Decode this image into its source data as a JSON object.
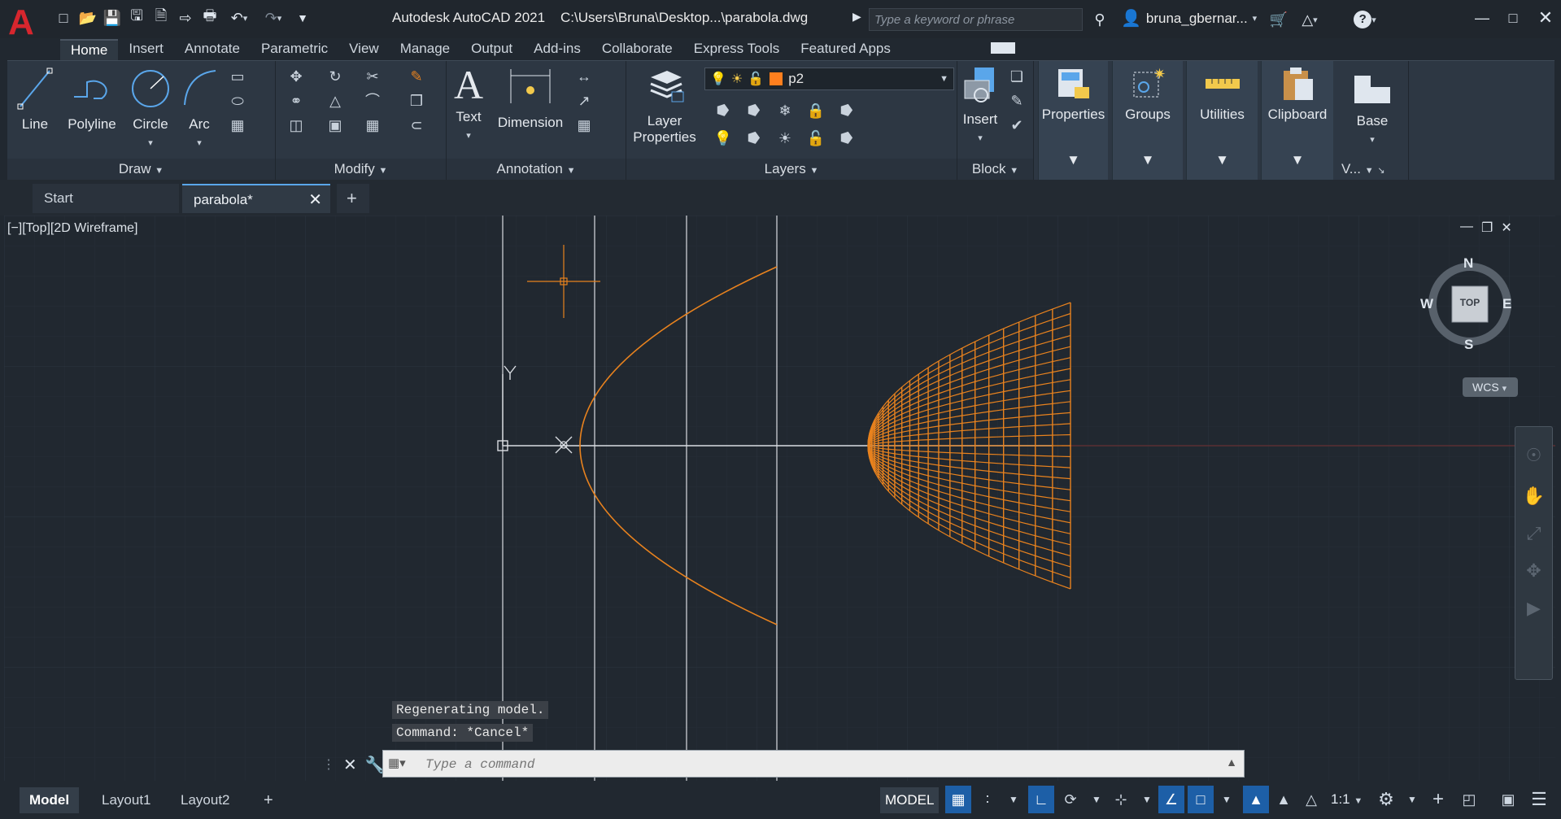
{
  "app": {
    "logo_letter": "A",
    "title": "Autodesk AutoCAD 2021",
    "filepath": "C:\\Users\\Bruna\\Desktop...\\parabola.dwg",
    "search_placeholder": "Type a keyword or phrase",
    "user": "bruna_gbernar...",
    "window_controls": [
      "minimize-icon",
      "maximize-icon",
      "close-icon"
    ]
  },
  "quick_access": [
    "new-icon",
    "open-icon",
    "save-icon",
    "save-as-icon",
    "publish-icon",
    "share-icon",
    "plot-icon",
    "undo-icon",
    "redo-icon",
    "customize-icon"
  ],
  "menu_tabs": [
    "Home",
    "Insert",
    "Annotate",
    "Parametric",
    "View",
    "Manage",
    "Output",
    "Add-ins",
    "Collaborate",
    "Express Tools",
    "Featured Apps"
  ],
  "active_tab": "Home",
  "ribbon": {
    "draw": {
      "title": "Draw",
      "tools": [
        "Line",
        "Polyline",
        "Circle",
        "Arc"
      ]
    },
    "modify": {
      "title": "Modify"
    },
    "annotation": {
      "title": "Annotation",
      "tools": [
        "Text",
        "Dimension"
      ]
    },
    "layers": {
      "title": "Layers",
      "layer_properties_line1": "Layer",
      "layer_properties_line2": "Properties",
      "current_layer": "p2",
      "layer_color": "#ff7f1e"
    },
    "block": {
      "title": "Block",
      "tools": [
        "Insert"
      ]
    },
    "collapsed": [
      "Properties",
      "Groups",
      "Utilities",
      "Clipboard"
    ],
    "base": {
      "label": "Base",
      "title": "V..."
    }
  },
  "doc_tabs": [
    {
      "label": "Start"
    },
    {
      "label": "parabola*"
    }
  ],
  "viewport": {
    "label": "[−][Top][2D Wireframe]",
    "controls": [
      "minimize-icon",
      "restore-icon",
      "close-icon"
    ]
  },
  "viewcube": {
    "north": "N",
    "south": "S",
    "east": "E",
    "west": "W",
    "face": "TOP",
    "ucs": "WCS"
  },
  "drawing": {
    "accent": "#e8821e",
    "line_color": "#d9dde2",
    "background": "#212830"
  },
  "command": {
    "history": [
      "Regenerating model.",
      "Command: *Cancel*"
    ],
    "placeholder": "Type a command"
  },
  "layout_tabs": [
    "Model",
    "Layout1",
    "Layout2"
  ],
  "status": {
    "model_label": "MODEL",
    "scale": "1:1"
  }
}
